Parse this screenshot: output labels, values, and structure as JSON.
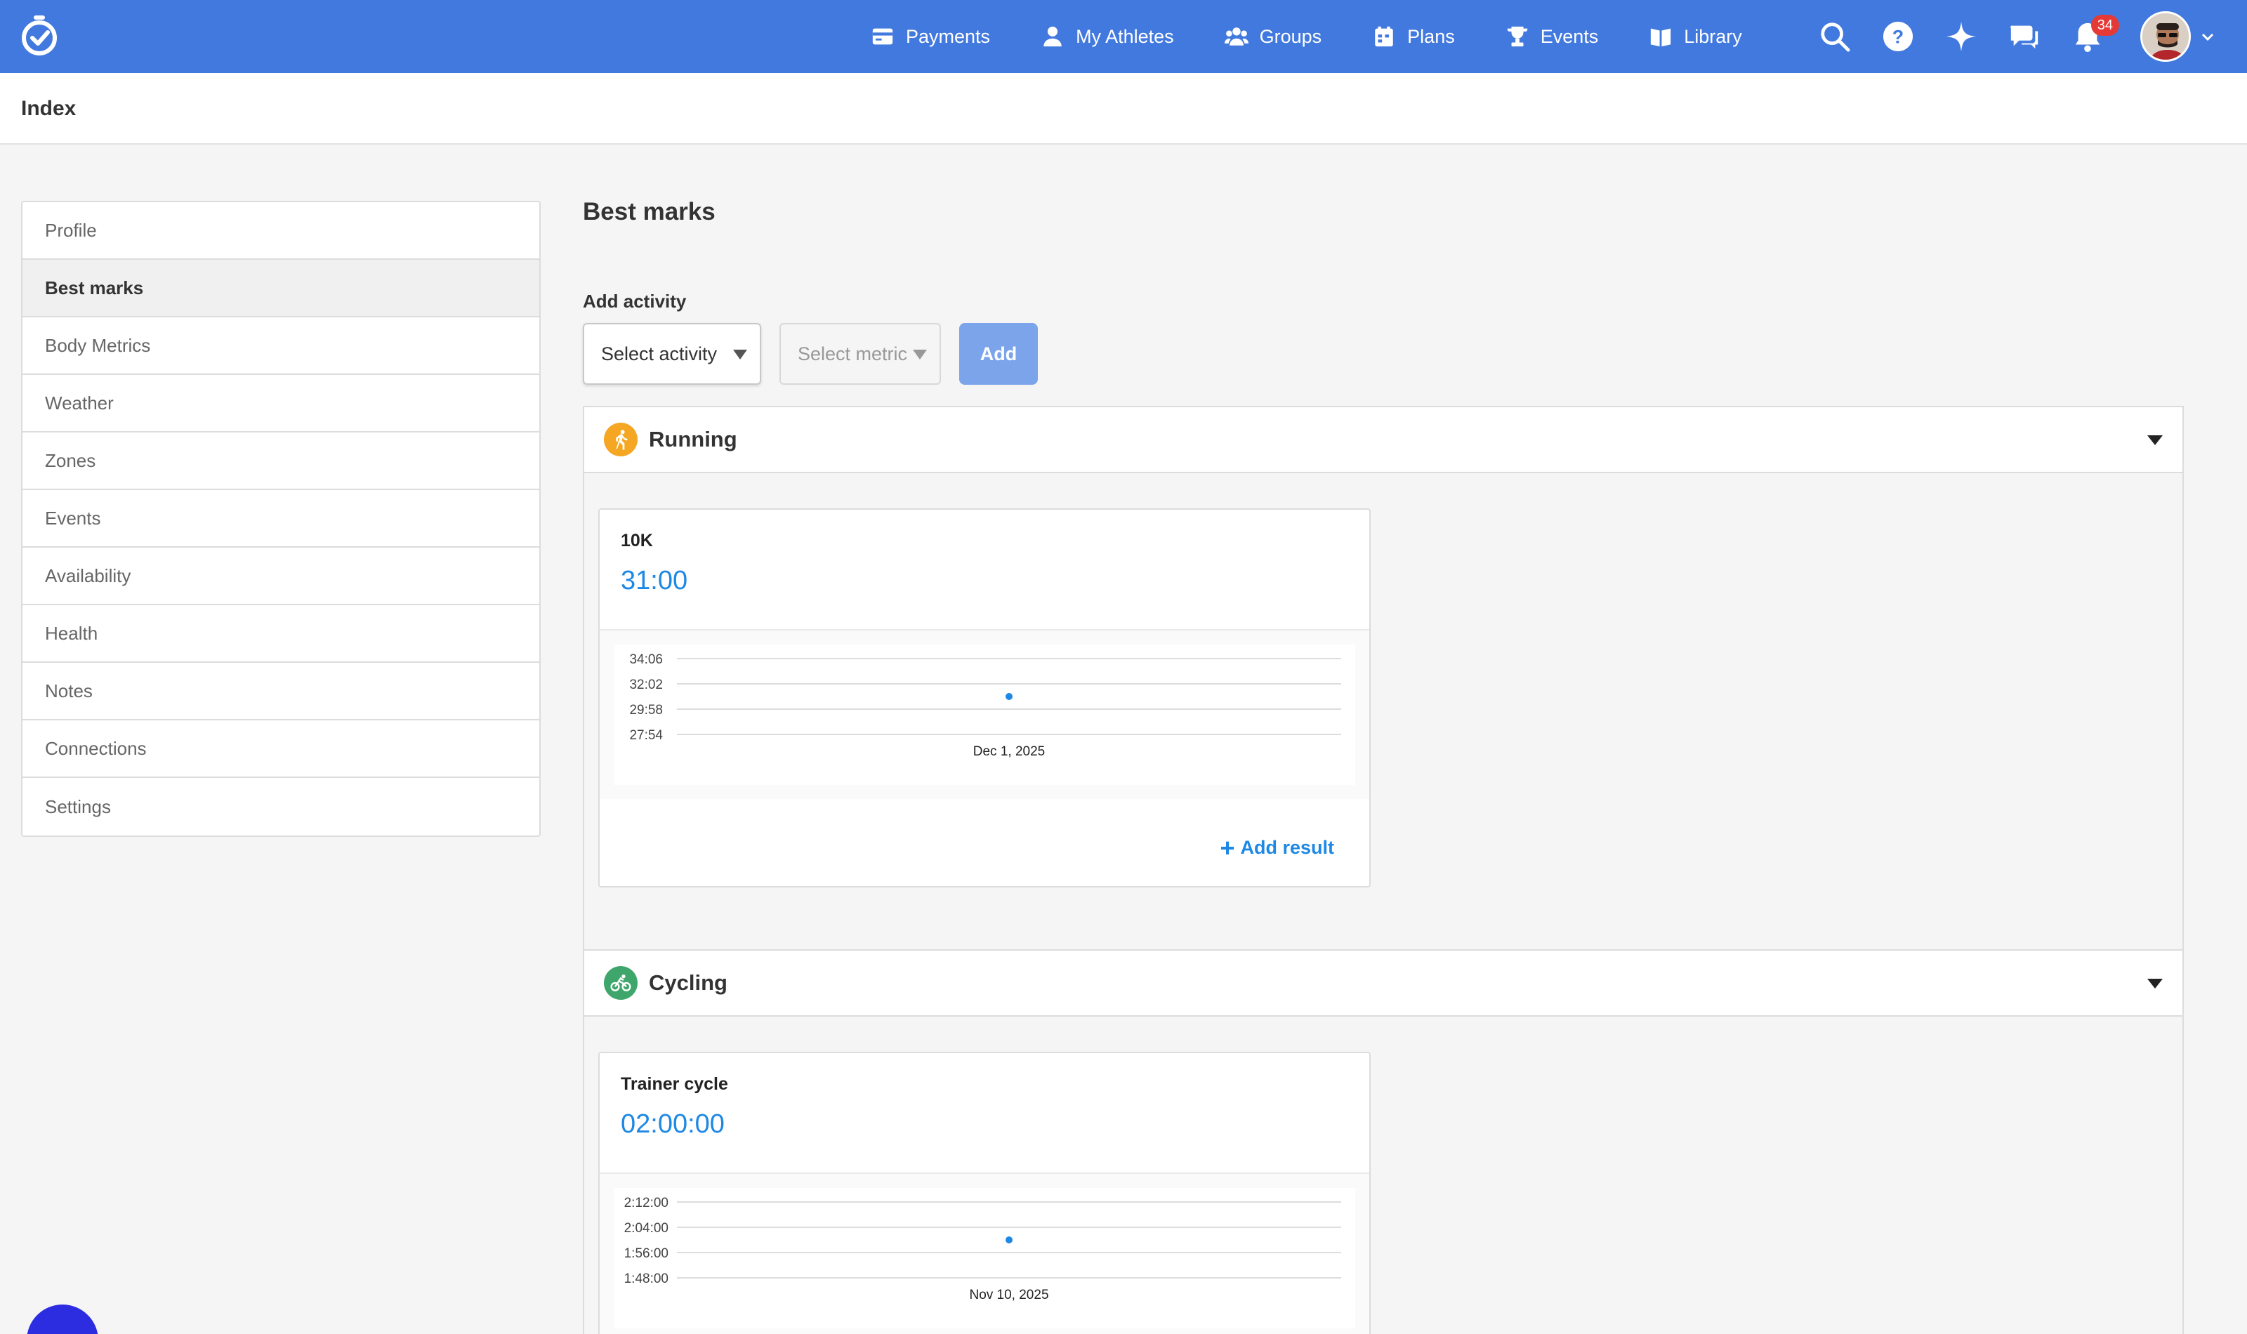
{
  "nav": {
    "links": [
      {
        "label": "Payments",
        "icon": "credit-card-icon"
      },
      {
        "label": "My Athletes",
        "icon": "user-icon"
      },
      {
        "label": "Groups",
        "icon": "users-icon"
      },
      {
        "label": "Plans",
        "icon": "calendar-icon"
      },
      {
        "label": "Events",
        "icon": "trophy-icon"
      },
      {
        "label": "Library",
        "icon": "book-icon"
      }
    ],
    "notification_count": "34"
  },
  "index": {
    "title": "Index"
  },
  "sidebar": {
    "items": [
      {
        "label": "Profile"
      },
      {
        "label": "Best marks",
        "active": true
      },
      {
        "label": "Body Metrics"
      },
      {
        "label": "Weather"
      },
      {
        "label": "Zones"
      },
      {
        "label": "Events"
      },
      {
        "label": "Availability"
      },
      {
        "label": "Health"
      },
      {
        "label": "Notes"
      },
      {
        "label": "Connections"
      },
      {
        "label": "Settings"
      }
    ]
  },
  "main": {
    "title": "Best marks",
    "add_activity_label": "Add activity",
    "select_activity_placeholder": "Select activity",
    "select_metric_placeholder": "Select metric",
    "add_button": "Add"
  },
  "sections": [
    {
      "name": "Running",
      "icon": "running-icon",
      "color": "#f5a623",
      "card": {
        "label": "10K",
        "value": "31:00",
        "add_result": "Add result",
        "chart": {
          "type": "scatter",
          "y_ticks": [
            "34:06",
            "32:02",
            "29:58",
            "27:54"
          ],
          "x_label": "Dec 1, 2025",
          "points": [
            {
              "x": "Dec 1, 2025",
              "y": "31:00"
            }
          ]
        }
      }
    },
    {
      "name": "Cycling",
      "icon": "cycling-icon",
      "color": "#3fa66b",
      "card": {
        "label": "Trainer cycle",
        "value": "02:00:00",
        "chart": {
          "type": "scatter",
          "y_ticks": [
            "2:12:00",
            "2:04:00",
            "1:56:00",
            "1:48:00"
          ],
          "x_label": "Nov 10, 2025",
          "points": [
            {
              "x": "Nov 10, 2025",
              "y": "2:00:00"
            }
          ]
        }
      }
    }
  ],
  "chart_data": [
    {
      "type": "scatter",
      "title": "",
      "x": [
        "Dec 1, 2025"
      ],
      "series": [
        {
          "values": [
            "31:00"
          ]
        }
      ],
      "y_ticks": [
        "34:06",
        "32:02",
        "29:58",
        "27:54"
      ]
    },
    {
      "type": "scatter",
      "title": "",
      "x": [
        "Nov 10, 2025"
      ],
      "series": [
        {
          "values": [
            "2:00:00"
          ]
        }
      ],
      "y_ticks": [
        "2:12:00",
        "2:04:00",
        "1:56:00",
        "1:48:00"
      ]
    }
  ],
  "colors": {
    "topbar": "#4279de",
    "accent": "#1e88e5",
    "add_button": "#7ba4ea",
    "badge": "#e53935"
  }
}
